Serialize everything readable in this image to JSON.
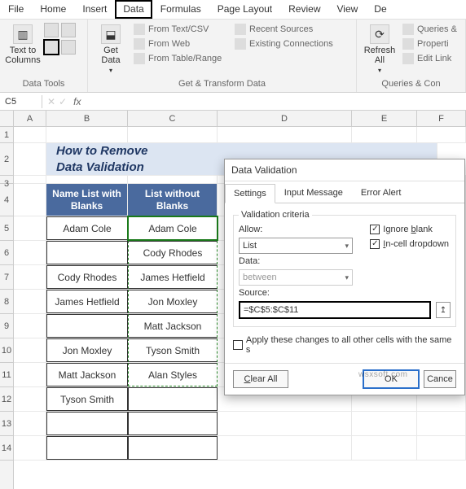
{
  "ribbon_tabs": [
    "File",
    "Home",
    "Insert",
    "Data",
    "Formulas",
    "Page Layout",
    "Review",
    "View",
    "De"
  ],
  "ribbon_active_tab": "Data",
  "ribbon": {
    "data_tools_label": "Data Tools",
    "text_to_columns": "Text to Columns",
    "get_data": "Get Data",
    "from_text_csv": "From Text/CSV",
    "from_web": "From Web",
    "from_table_range": "From Table/Range",
    "recent_sources": "Recent Sources",
    "existing_connections": "Existing Connections",
    "get_transform_label": "Get & Transform Data",
    "refresh_all": "Refresh All",
    "queries": "Queries &",
    "properties": "Properti",
    "edit_link": "Edit Link",
    "queries_con_label": "Queries & Con"
  },
  "namebox": "C5",
  "fx": "fx",
  "columns": [
    "A",
    "B",
    "C",
    "D",
    "E",
    "F"
  ],
  "rows": [
    1,
    2,
    3,
    4,
    5,
    6,
    7,
    8,
    9,
    10,
    11,
    12,
    13,
    14
  ],
  "title_line1": "How to Remove",
  "title_line2": "Data Validation",
  "headers": {
    "b": "Name List with Blanks",
    "c": "List without Blanks"
  },
  "data_b": [
    "Adam Cole",
    "",
    "Cody Rhodes",
    "James Hetfield",
    "",
    "Jon Moxley",
    "Matt Jackson",
    "Tyson Smith",
    "",
    ""
  ],
  "data_c": [
    "Adam Cole",
    "Cody Rhodes",
    "James Hetfield",
    "Jon Moxley",
    "Matt Jackson",
    "Tyson Smith",
    "Alan Styles",
    "",
    "",
    ""
  ],
  "dialog": {
    "title": "Data Validation",
    "tabs": [
      "Settings",
      "Input Message",
      "Error Alert"
    ],
    "active_tab": "Settings",
    "criteria_label": "Validation criteria",
    "allow_label": "Allow:",
    "allow_value": "List",
    "ignore_blank": "Ignore blank",
    "ignore_blank_u": "b",
    "incell_dropdown": "In-cell dropdown",
    "incell_u": "I",
    "data_label": "Data:",
    "data_value": "between",
    "source_label": "Source:",
    "source_value": "=$C$5:$C$11",
    "apply_changes": "Apply these changes to all other cells with the same s",
    "apply_u": "P",
    "clear_all": "Clear All",
    "clear_u": "C",
    "ok": "OK",
    "cancel": "Cance"
  },
  "watermark": "wsxsoft.com"
}
